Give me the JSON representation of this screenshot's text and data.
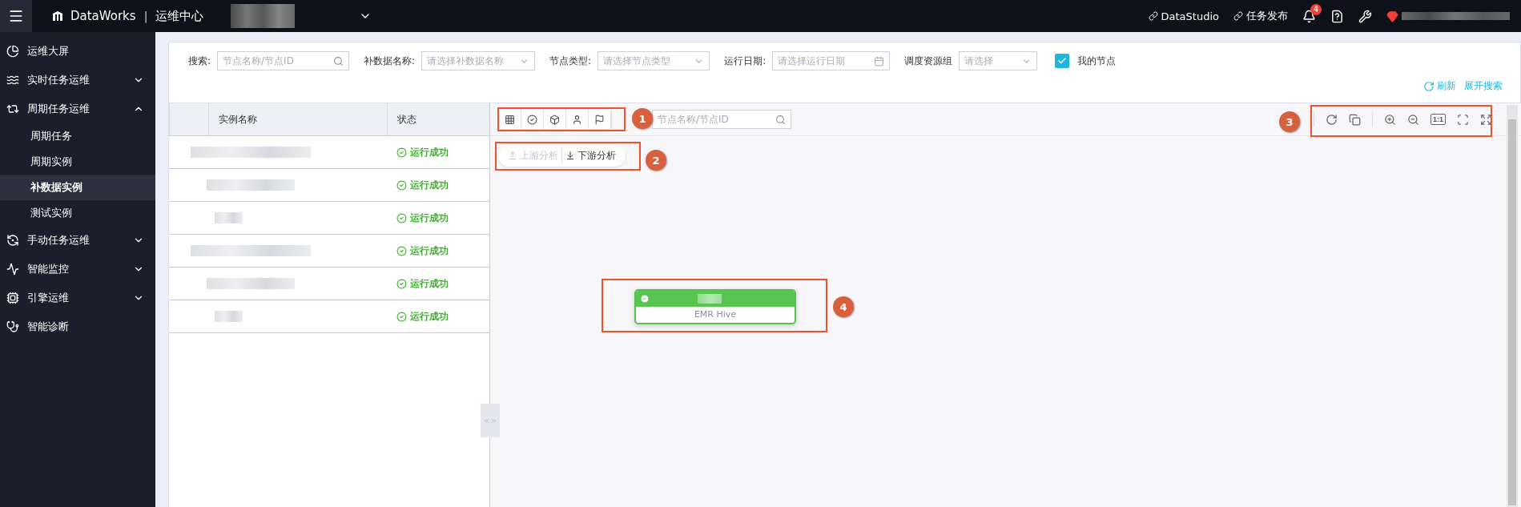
{
  "topbar": {
    "product": "DataWorks",
    "separator": "|",
    "module": "运维中心",
    "links": [
      "DataStudio",
      "任务发布"
    ],
    "notifications": "4"
  },
  "sidebar": {
    "items": [
      {
        "label": "运维大屏"
      },
      {
        "label": "实时任务运维",
        "expanded": false
      },
      {
        "label": "周期任务运维",
        "expanded": true,
        "children": [
          {
            "label": "周期任务",
            "selected": false
          },
          {
            "label": "周期实例",
            "selected": false
          },
          {
            "label": "补数据实例",
            "selected": true
          },
          {
            "label": "测试实例",
            "selected": false
          }
        ]
      },
      {
        "label": "手动任务运维",
        "expanded": false
      },
      {
        "label": "智能监控",
        "expanded": false
      },
      {
        "label": "引擎运维",
        "expanded": false
      },
      {
        "label": "智能诊断"
      }
    ]
  },
  "filters": [
    {
      "kind": "search",
      "label": "搜索:",
      "placeholder": "节点名称/节点ID"
    },
    {
      "kind": "select",
      "label": "补数据名称:",
      "placeholder": "请选择补数据名称"
    },
    {
      "kind": "select",
      "label": "节点类型:",
      "placeholder": "请选择节点类型"
    },
    {
      "kind": "date",
      "label": "运行日期:",
      "placeholder": "请选择运行日期"
    },
    {
      "kind": "select",
      "label": "调度资源组",
      "placeholder": "请选择"
    }
  ],
  "my_nodes": {
    "label": "我的节点",
    "checked": true
  },
  "actions": {
    "refresh": "刷新",
    "expand_search": "展开搜索"
  },
  "table": {
    "columns": [
      "实例名称",
      "状态"
    ],
    "rows": [
      {
        "status": "运行成功"
      },
      {
        "status": "运行成功"
      },
      {
        "status": "运行成功"
      },
      {
        "status": "运行成功"
      },
      {
        "status": "运行成功"
      },
      {
        "status": "运行成功"
      }
    ]
  },
  "graph": {
    "search_placeholder": "节点名称/节点ID",
    "analysis": [
      {
        "label": "上游分析",
        "disabled": true
      },
      {
        "label": "下游分析",
        "disabled": false
      }
    ],
    "zoom_label": "1:1",
    "node": {
      "type": "EMR Hive"
    }
  },
  "annotations": [
    "1",
    "2",
    "3",
    "4"
  ]
}
